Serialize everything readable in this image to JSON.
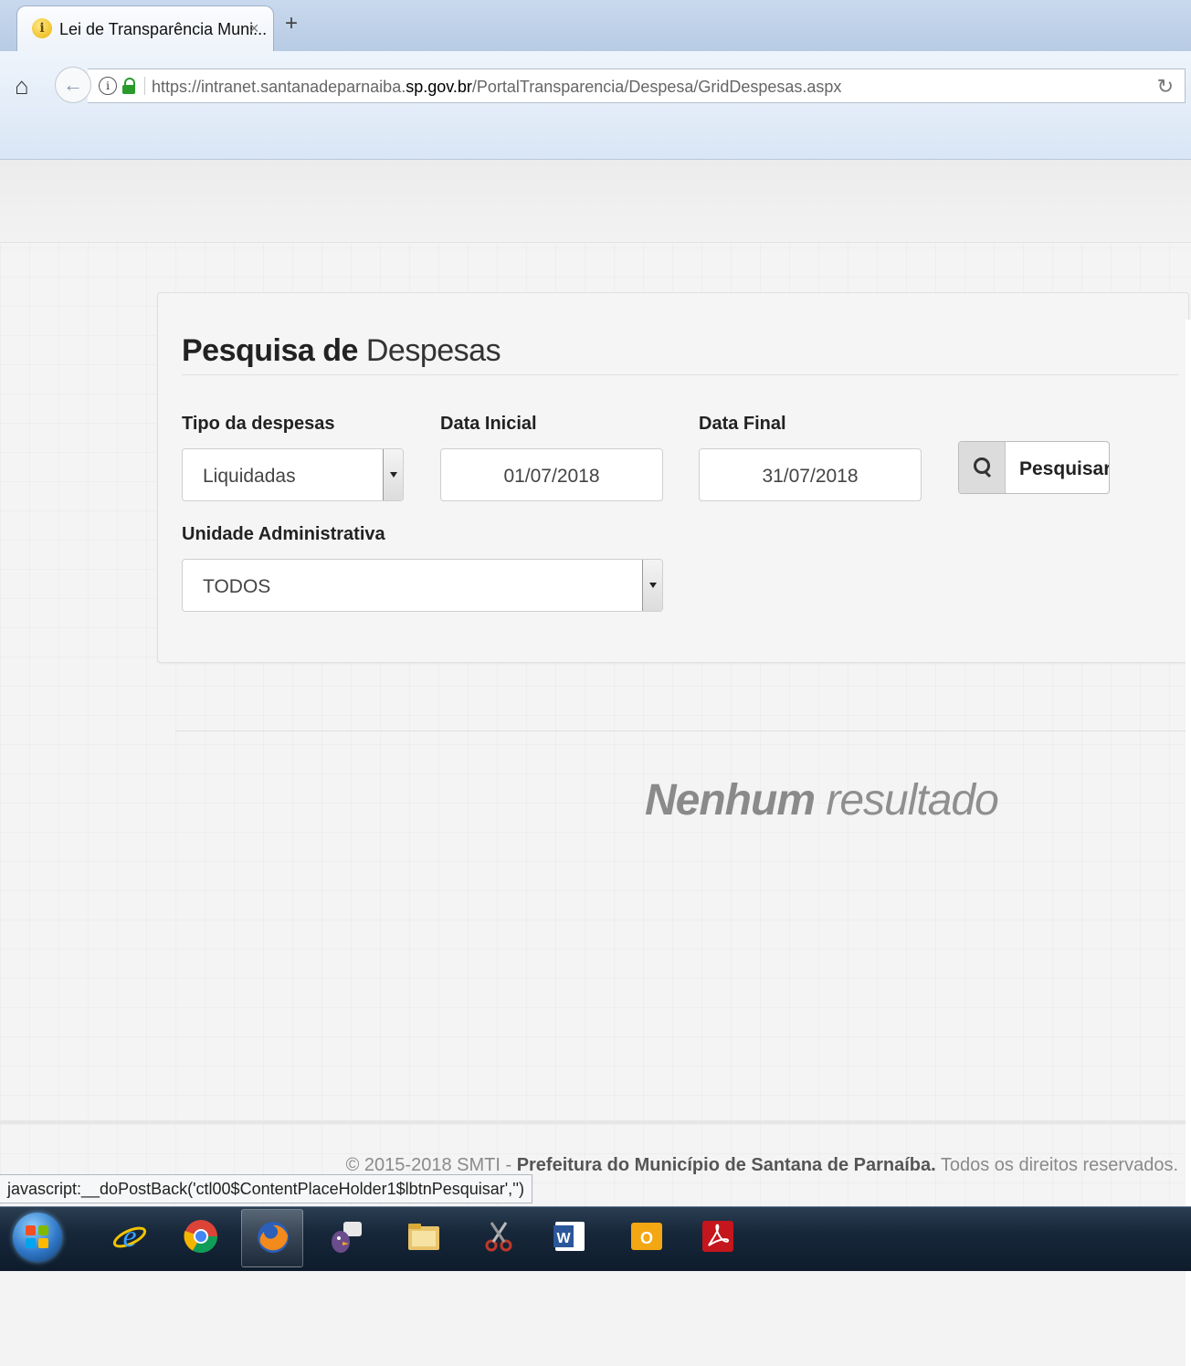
{
  "browser": {
    "tab_title": "Lei de Transparência Muni...",
    "tab_close": "×",
    "new_tab": "+",
    "url_prefix": "https://intranet.santanadeparnaiba.",
    "url_domain": "sp.gov.br",
    "url_path": "/PortalTransparencia/Despesa/GridDespesas.aspx",
    "site_info": "i"
  },
  "panel": {
    "title_strong": "Pesquisa de",
    "title_light": "Despesas",
    "tipo_label": "Tipo da despesas",
    "tipo_value": "Liquidadas",
    "data_inicial_label": "Data Inicial",
    "data_inicial_value": "01/07/2018",
    "data_final_label": "Data Final",
    "data_final_value": "31/07/2018",
    "search_button_label": "Pesquisar",
    "unidade_label": "Unidade Administrativa",
    "unidade_value": "TODOS"
  },
  "results": {
    "no_results_bold": "Nenhum",
    "no_results_rest": "resultado"
  },
  "footer": {
    "copyright": "© 2015-2018 SMTI - ",
    "org": "Prefeitura do Município de Santana de Parnaíba.",
    "rights": " Todos os direitos reservados."
  },
  "status_bar": {
    "link": "javascript:__doPostBack('ctl00$ContentPlaceHolder1$lbtnPesquisar','')"
  },
  "taskbar": {
    "items": [
      "internet-explorer",
      "chrome",
      "firefox",
      "pidgin",
      "file-explorer",
      "snipping-tool",
      "word",
      "outlook",
      "acrobat"
    ]
  }
}
